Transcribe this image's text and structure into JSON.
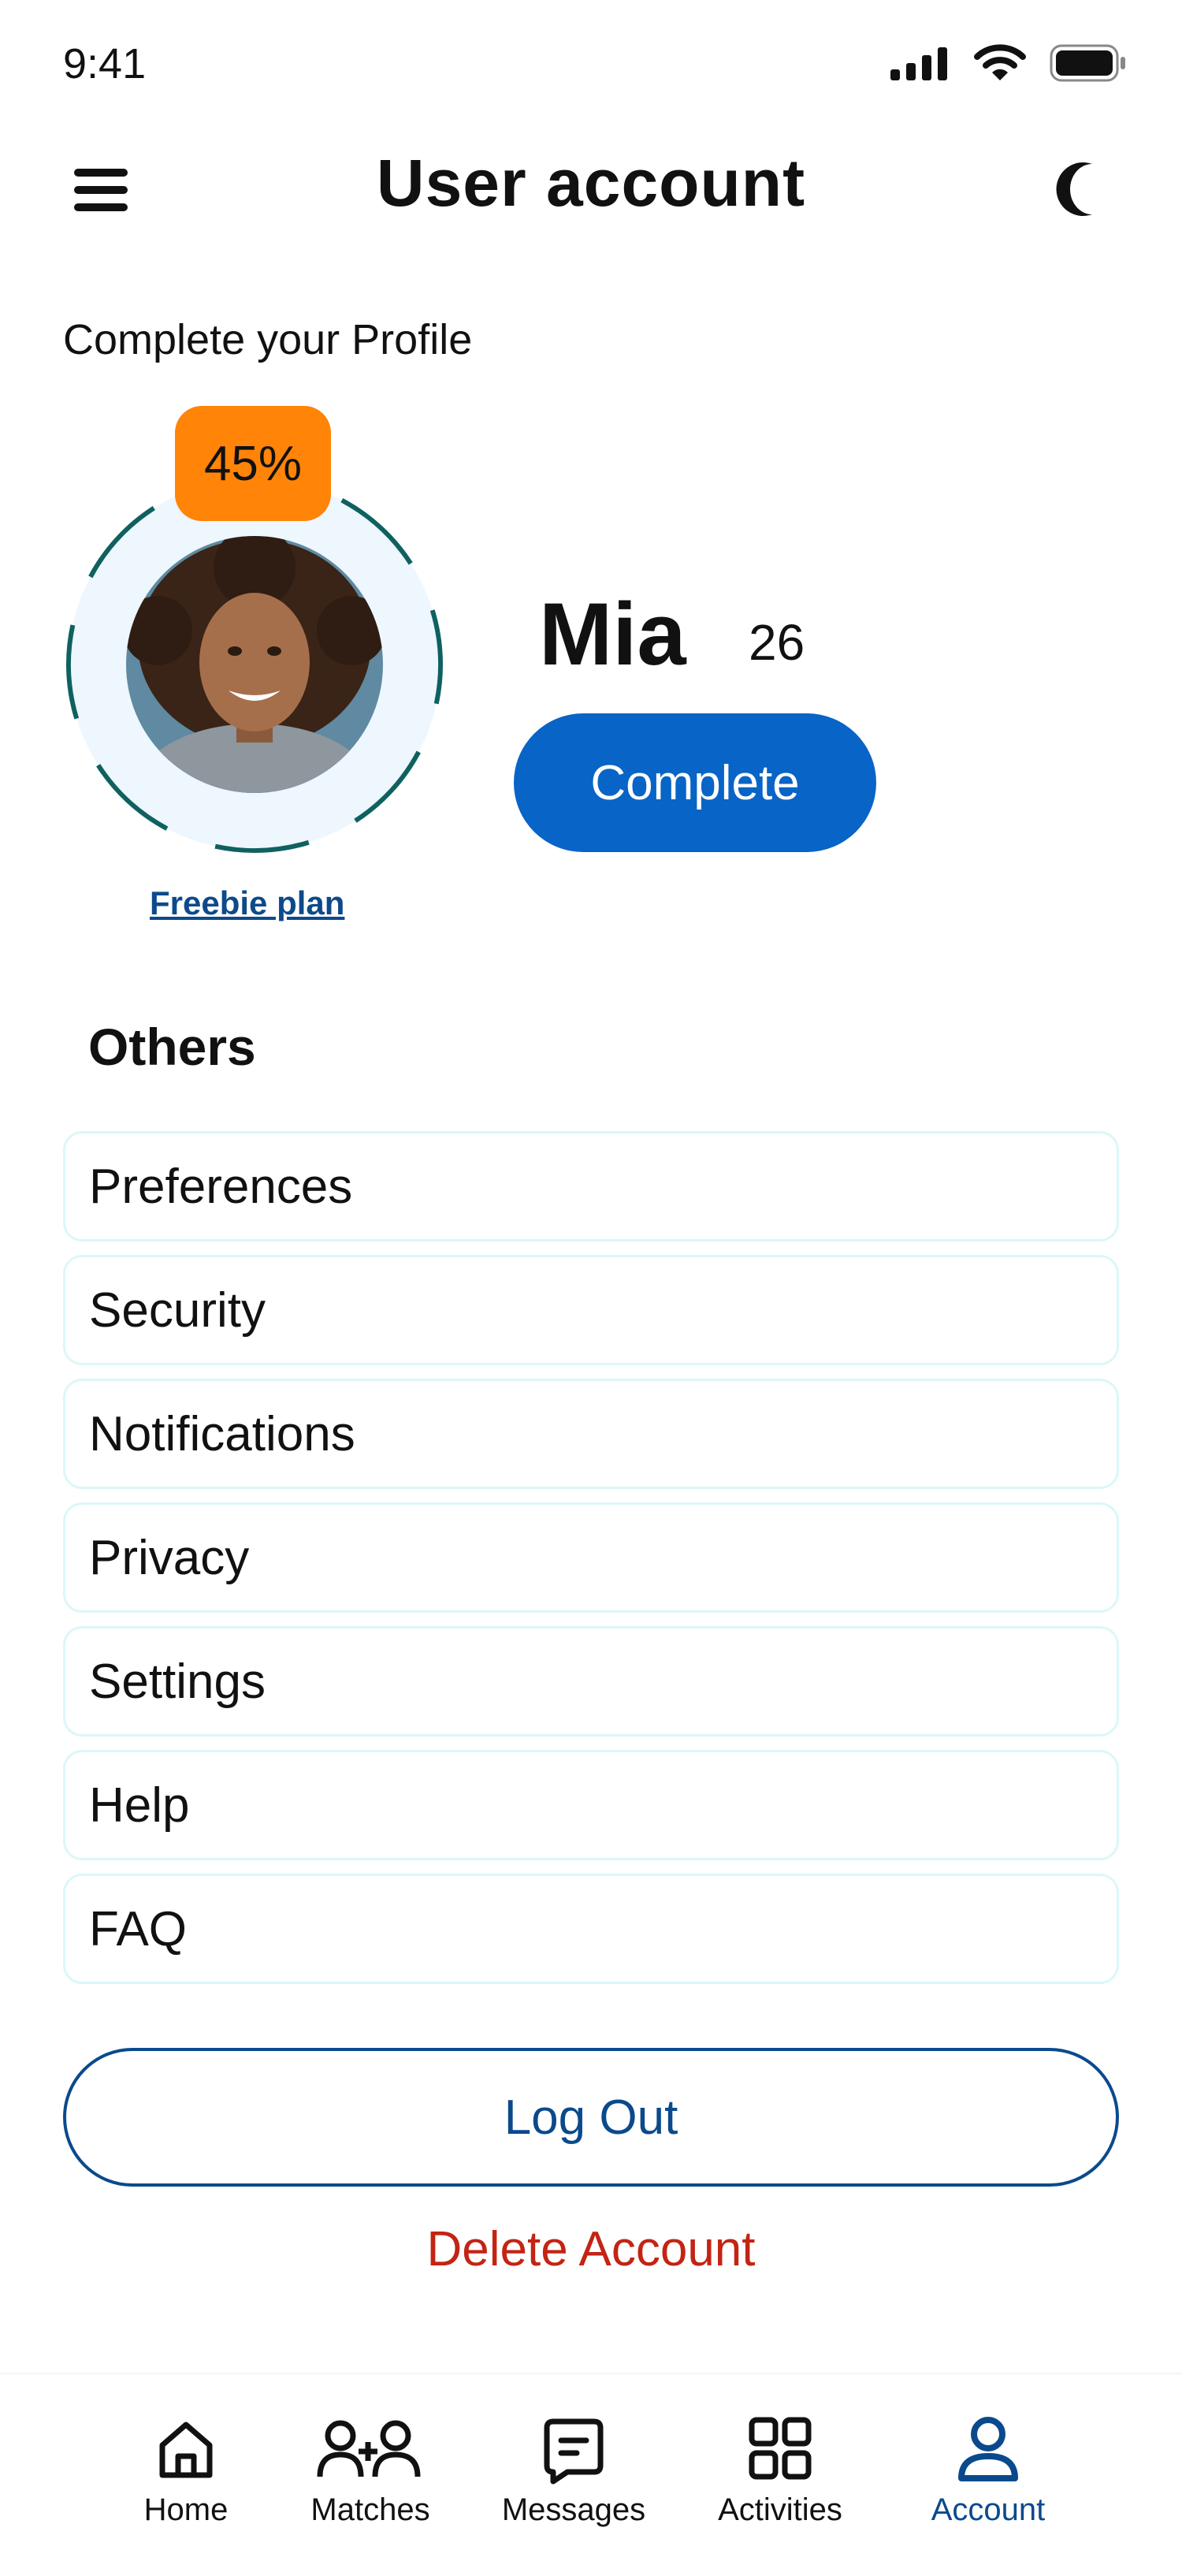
{
  "status_bar": {
    "time": "9:41"
  },
  "header": {
    "title": "User account"
  },
  "profile": {
    "complete_heading": "Complete your Profile",
    "progress_percent": 45,
    "progress_label": "45%",
    "plan_link": "Freebie plan",
    "name": "Mia",
    "age": "26",
    "complete_button": "Complete"
  },
  "others": {
    "title": "Others",
    "items": [
      {
        "label": "Preferences"
      },
      {
        "label": "Security"
      },
      {
        "label": "Notifications"
      },
      {
        "label": "Privacy"
      },
      {
        "label": "Settings"
      },
      {
        "label": "Help"
      },
      {
        "label": "FAQ"
      }
    ]
  },
  "actions": {
    "logout": "Log Out",
    "delete": "Delete Account"
  },
  "tabs": [
    {
      "label": "Home",
      "icon": "home-icon"
    },
    {
      "label": "Matches",
      "icon": "matches-icon"
    },
    {
      "label": "Messages",
      "icon": "messages-icon"
    },
    {
      "label": "Activities",
      "icon": "activities-icon"
    },
    {
      "label": "Account",
      "icon": "account-icon",
      "active": true
    }
  ],
  "colors": {
    "primary": "#0864c6",
    "navy": "#0a4a8c",
    "badge": "#ff8407",
    "danger": "#c32414",
    "ring": "#0f6160",
    "ring_fill": "#eef6fe"
  }
}
